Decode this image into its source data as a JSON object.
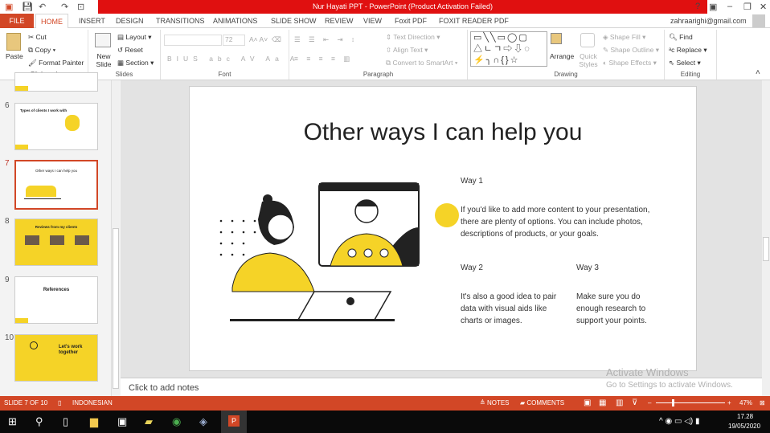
{
  "window": {
    "title": "Nur Hayati PPT -  PowerPoint (Product Activation Failed)",
    "user": "zahraarighi@gmail.com",
    "help": "?"
  },
  "tabs": [
    "FILE",
    "HOME",
    "INSERT",
    "DESIGN",
    "TRANSITIONS",
    "ANIMATIONS",
    "SLIDE SHOW",
    "REVIEW",
    "VIEW",
    "Foxit PDF",
    "FOXIT READER PDF"
  ],
  "ribbon": {
    "clipboard": {
      "label": "Clipboard",
      "paste": "Paste",
      "cut": "Cut",
      "copy": "Copy",
      "format_painter": "Format Painter"
    },
    "slides": {
      "label": "Slides",
      "new_slide": "New Slide",
      "layout": "Layout",
      "reset": "Reset",
      "section": "Section"
    },
    "font": {
      "label": "Font",
      "size": "72"
    },
    "paragraph": {
      "label": "Paragraph",
      "text_direction": "Text Direction",
      "align_text": "Align Text",
      "convert": "Convert to SmartArt"
    },
    "drawing": {
      "label": "Drawing",
      "arrange": "Arrange",
      "quick_styles": "Quick Styles",
      "shape_fill": "Shape Fill",
      "shape_outline": "Shape Outline",
      "shape_effects": "Shape Effects"
    },
    "editing": {
      "label": "Editing",
      "find": "Find",
      "replace": "Replace",
      "select": "Select"
    }
  },
  "thumbnails": [
    {
      "num": "6",
      "title": "Types of clients I work with"
    },
    {
      "num": "7",
      "title": "Other ways I can help you"
    },
    {
      "num": "8",
      "title": "Reviews from my clients"
    },
    {
      "num": "9",
      "title": "References"
    },
    {
      "num": "10",
      "title": "Let's work together"
    }
  ],
  "slide": {
    "title": "Other ways I can help you",
    "way1_title": "Way 1",
    "way1_text": "If you'd like to add more content to your presentation, there are plenty of options. You can include photos, descriptions of products, or your goals.",
    "way2_title": "Way 2",
    "way2_text": "It's also a good idea to pair data with visual aids like charts or images.",
    "way3_title": "Way 3",
    "way3_text": "Make sure you do enough research to support your points."
  },
  "notes_placeholder": "Click to add notes",
  "watermark": {
    "title": "Activate Windows",
    "subtitle": "Go to Settings to activate Windows."
  },
  "status": {
    "slide": "SLIDE 7 OF 10",
    "language": "INDONESIAN",
    "notes": "NOTES",
    "comments": "COMMENTS",
    "zoom": "47%",
    "zoom_fraction": 0.47
  },
  "taskbar": {
    "time": "17.28",
    "date": "19/05/2020"
  },
  "colors": {
    "accent": "#d24726",
    "title_red": "#e01010",
    "yellow": "#f5d327"
  }
}
